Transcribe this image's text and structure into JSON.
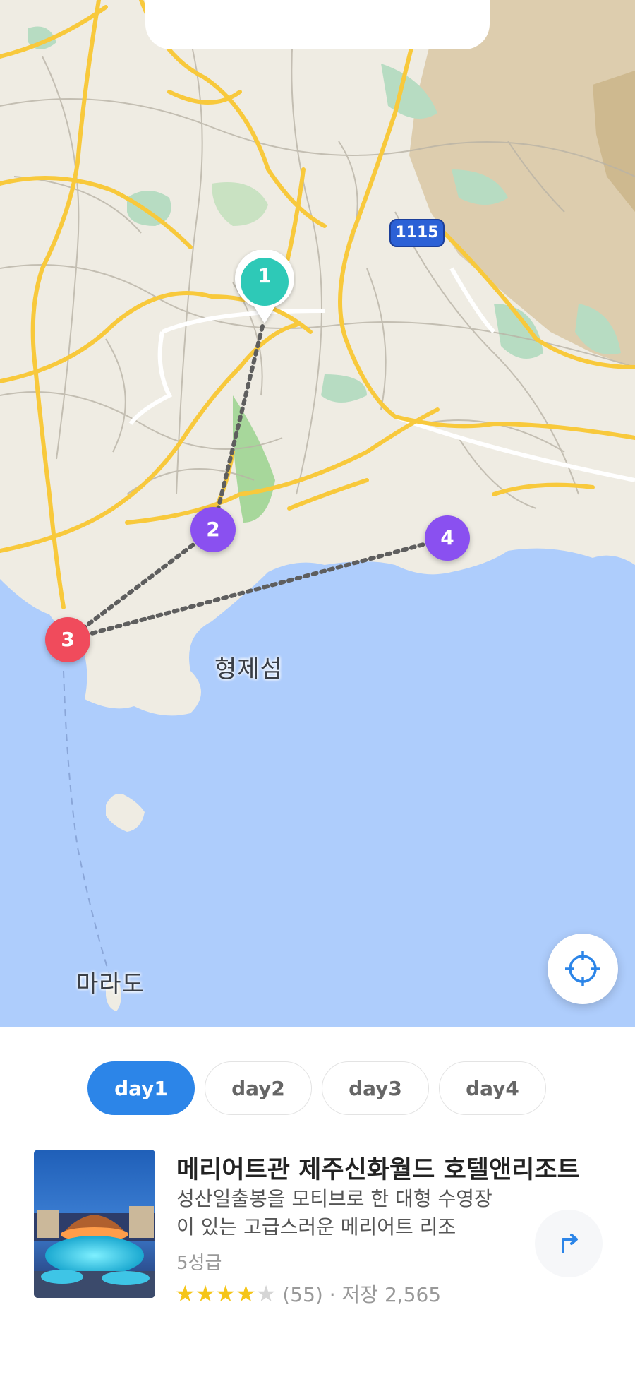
{
  "map": {
    "route_badge": "1115",
    "labels": {
      "island_hyeongje": "형제섬",
      "island_mara": "마라도"
    },
    "pins": [
      {
        "number": "1",
        "color": "#2ec9b7"
      },
      {
        "number": "2",
        "color": "#8a50f0"
      },
      {
        "number": "3",
        "color": "#f04b5c"
      },
      {
        "number": "4",
        "color": "#8a50f0"
      }
    ],
    "locate_icon": "crosshair-icon"
  },
  "tabs": [
    {
      "label": "day1",
      "active": true
    },
    {
      "label": "day2",
      "active": false
    },
    {
      "label": "day3",
      "active": false
    },
    {
      "label": "day4",
      "active": false
    }
  ],
  "place": {
    "title": "메리어트관 제주신화월드 호텔앤리조트",
    "description": "성산일출봉을 모티브로 한 대형 수영장이 있는 고급스러운 메리어트 리조",
    "grade": "5성급",
    "rating_stars": 4,
    "review_count": "(55)",
    "saves": "· 저장 2,565",
    "direction_icon": "turn-right-arrow-icon"
  },
  "colors": {
    "accent": "#2c85e8",
    "sea": "#aecdfc",
    "land": "#efece3",
    "road": "#f8c93c"
  }
}
